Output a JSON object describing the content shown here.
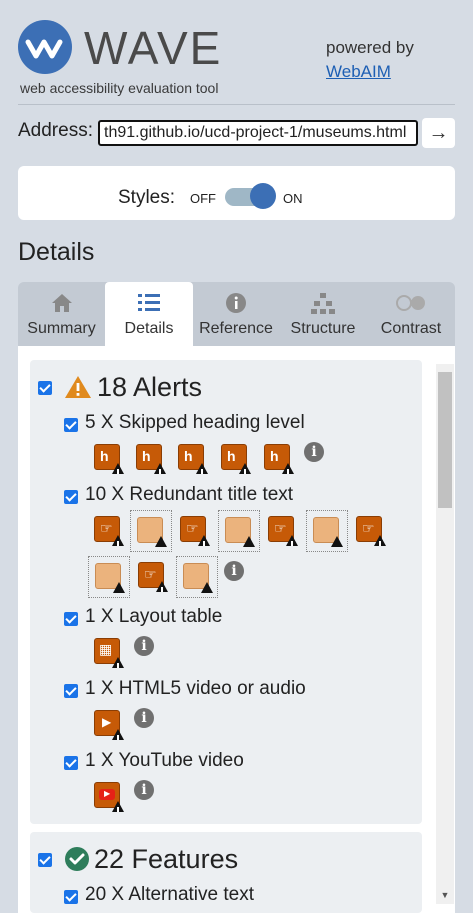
{
  "header": {
    "logo_text": "WAVE",
    "tagline": "web accessibility evaluation tool",
    "powered_by": "powered by",
    "webaim_link": "WebAIM"
  },
  "address": {
    "label": "Address:",
    "value": "th91.github.io/ucd-project-1/museums.html",
    "go_icon": "arrow-right-icon"
  },
  "styles": {
    "label": "Styles:",
    "off": "OFF",
    "on": "ON",
    "state": "on"
  },
  "section_title": "Details",
  "tabs": [
    {
      "label": "Summary",
      "icon": "home-icon",
      "active": false
    },
    {
      "label": "Details",
      "icon": "list-icon",
      "active": true
    },
    {
      "label": "Reference",
      "icon": "info-icon",
      "active": false
    },
    {
      "label": "Structure",
      "icon": "structure-icon",
      "active": false
    },
    {
      "label": "Contrast",
      "icon": "contrast-icon",
      "active": false
    }
  ],
  "alerts": {
    "heading": "18 Alerts",
    "items": [
      {
        "label": "5 X Skipped heading level",
        "icon_count": 5
      },
      {
        "label": "10 X Redundant title text",
        "icon_count": 10
      },
      {
        "label": "1 X Layout table",
        "icon_count": 1
      },
      {
        "label": "1 X HTML5 video or audio",
        "icon_count": 1
      },
      {
        "label": "1 X YouTube video",
        "icon_count": 1
      }
    ]
  },
  "features": {
    "heading": "22 Features",
    "items": [
      {
        "label": "20 X Alternative text"
      }
    ]
  },
  "colors": {
    "accent": "#3c6fb5",
    "alert_orange": "#c65a07",
    "checkbox": "#1a73e8",
    "feature_green": "#2e7d5b"
  }
}
